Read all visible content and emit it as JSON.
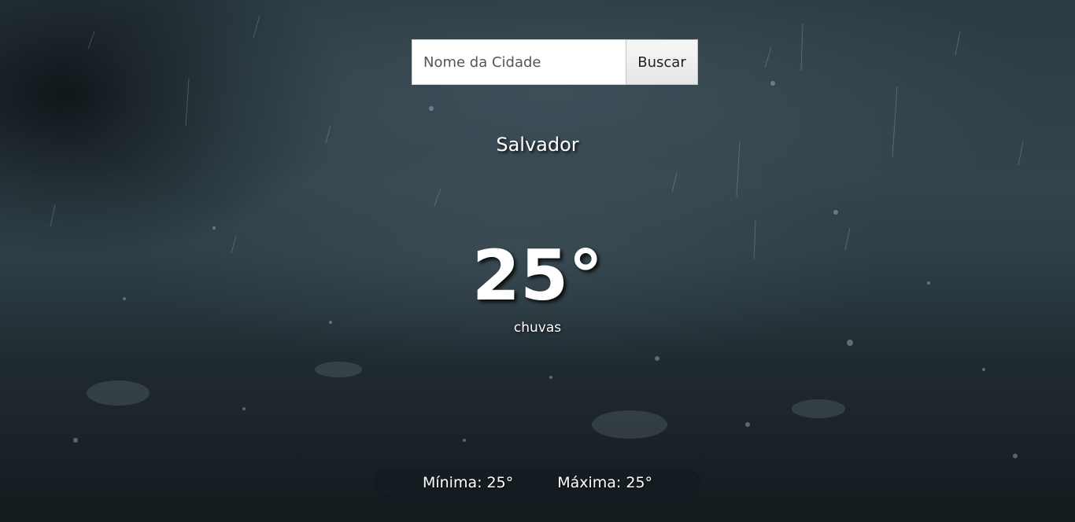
{
  "search": {
    "placeholder": "Nome da Cidade",
    "value": "",
    "button_label": "Buscar"
  },
  "weather": {
    "city": "Salvador",
    "temperature": "25°",
    "description": "chuvas",
    "min_label": "Mínima: 25°",
    "max_label": "Máxima: 25°"
  },
  "background": {
    "scene": "rain on pavement at night",
    "base_color": "#26333b"
  }
}
